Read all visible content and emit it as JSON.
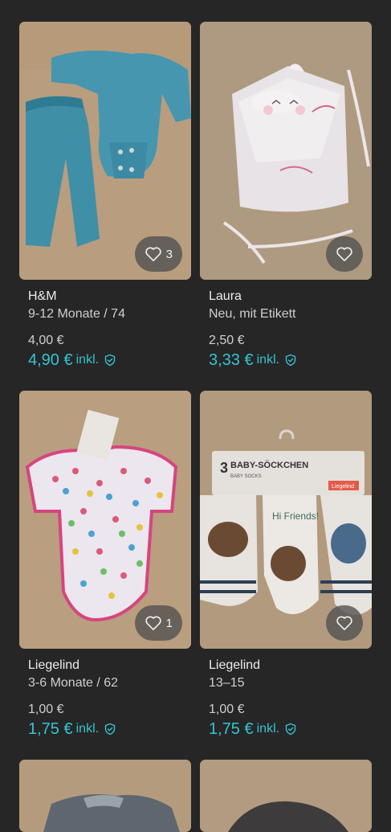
{
  "items": [
    {
      "brand": "H&M",
      "size": "9-12 Monate / 74",
      "price": "4,00 €",
      "price_incl": "4,90 €",
      "incl_label": "inkl.",
      "favorites": "3",
      "photo": "blue-bodysuit-and-pants"
    },
    {
      "brand": "Laura",
      "size": "Neu, mit Etikett",
      "price": "2,50 €",
      "price_incl": "3,33 €",
      "incl_label": "inkl.",
      "favorites": "",
      "photo": "white-hooded-towel"
    },
    {
      "brand": "Liegelind",
      "size": "3-6 Monate / 62",
      "price": "1,00 €",
      "price_incl": "1,75 €",
      "incl_label": "inkl.",
      "favorites": "1",
      "photo": "heart-print-bodysuit"
    },
    {
      "brand": "Liegelind",
      "size": "13–15",
      "price": "1,00 €",
      "price_incl": "1,75 €",
      "incl_label": "inkl.",
      "favorites": "",
      "photo": "baby-socks-pack"
    }
  ],
  "socks_label": {
    "count": "3",
    "title": "BABY-SÖCKCHEN",
    "subtitle": "BABY SOCKS",
    "brand_tag": "Liegelind",
    "sock_text": "Hi Friends!"
  },
  "colors": {
    "background": "#262626",
    "accent": "#35c4d3",
    "text_primary": "#ececec",
    "text_secondary": "#cfcfcf"
  }
}
